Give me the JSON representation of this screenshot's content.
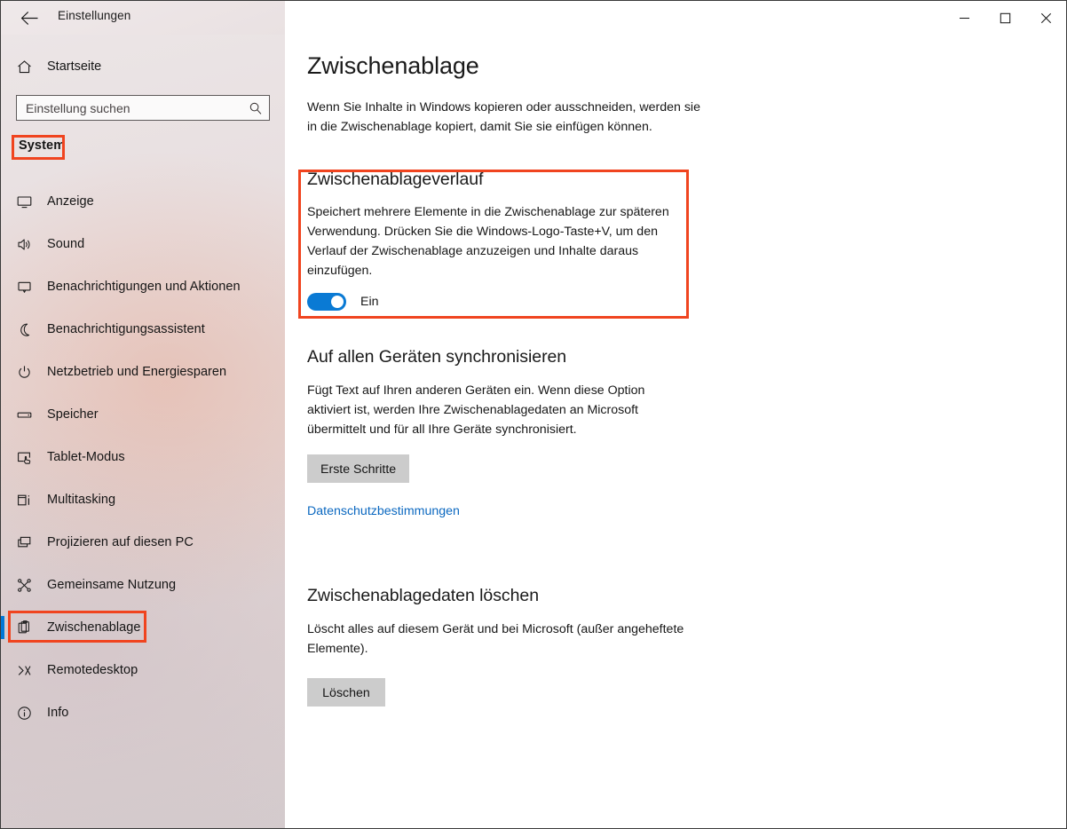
{
  "window": {
    "title": "Einstellungen",
    "back_icon": "back-arrow-icon",
    "controls": {
      "minimize": "minimize-icon",
      "maximize": "maximize-icon",
      "close": "close-icon"
    }
  },
  "sidebar": {
    "home": {
      "label": "Startseite",
      "icon": "home-icon"
    },
    "search": {
      "value": "",
      "placeholder": "Einstellung suchen",
      "icon": "search-icon"
    },
    "group_header": "System",
    "items": [
      {
        "label": "Anzeige",
        "icon": "monitor-icon",
        "selected": false
      },
      {
        "label": "Sound",
        "icon": "speaker-icon",
        "selected": false
      },
      {
        "label": "Benachrichtigungen und Aktionen",
        "icon": "chat-bubble-icon",
        "selected": false
      },
      {
        "label": "Benachrichtigungsassistent",
        "icon": "moon-icon",
        "selected": false
      },
      {
        "label": "Netzbetrieb und Energiesparen",
        "icon": "power-icon",
        "selected": false
      },
      {
        "label": "Speicher",
        "icon": "drive-icon",
        "selected": false
      },
      {
        "label": "Tablet-Modus",
        "icon": "tablet-hand-icon",
        "selected": false
      },
      {
        "label": "Multitasking",
        "icon": "multitask-icon",
        "selected": false
      },
      {
        "label": "Projizieren auf diesen PC",
        "icon": "project-icon",
        "selected": false
      },
      {
        "label": "Gemeinsame Nutzung",
        "icon": "share-nodes-icon",
        "selected": false
      },
      {
        "label": "Zwischenablage",
        "icon": "clipboard-icon",
        "selected": true
      },
      {
        "label": "Remotedesktop",
        "icon": "remote-desktop-icon",
        "selected": false
      },
      {
        "label": "Info",
        "icon": "info-icon",
        "selected": false
      }
    ]
  },
  "main": {
    "title": "Zwischenablage",
    "intro": "Wenn Sie Inhalte in Windows kopieren oder ausschneiden, werden sie in die Zwischenablage kopiert, damit Sie sie einfügen können.",
    "history": {
      "heading": "Zwischenablageverlauf",
      "description": "Speichert mehrere Elemente in die Zwischenablage zur späteren Verwendung. Drücken Sie die Windows-Logo-Taste+V, um den Verlauf der Zwischenablage anzuzeigen und Inhalte daraus einzufügen.",
      "toggle_state": "Ein",
      "toggle_on": true
    },
    "sync": {
      "heading": "Auf allen Geräten synchronisieren",
      "description": "Fügt Text auf Ihren anderen Geräten ein. Wenn diese Option aktiviert ist, werden Ihre Zwischenablagedaten an Microsoft übermittelt und für all Ihre Geräte synchronisiert.",
      "button_label": "Erste Schritte",
      "privacy_link": "Datenschutzbestimmungen"
    },
    "clear": {
      "heading": "Zwischenablagedaten löschen",
      "description": "Löscht alles auf diesem Gerät und bei Microsoft (außer angeheftete Elemente).",
      "button_label": "Löschen"
    }
  },
  "colors": {
    "accent_blue": "#0078D7",
    "toggle_blue": "#0A7AD4",
    "highlight_red": "#F0441F",
    "link_blue": "#0B68C0",
    "button_gray": "#CCCCCC"
  }
}
